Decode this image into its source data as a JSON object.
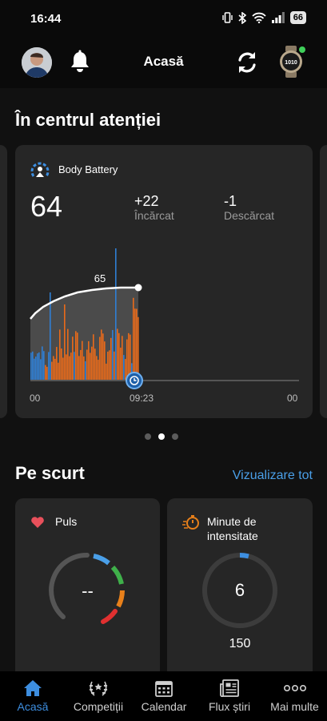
{
  "status_bar": {
    "time": "16:44",
    "battery": "66"
  },
  "header": {
    "title": "Acasă"
  },
  "spotlight": {
    "title": "În centrul atenției",
    "card": {
      "title": "Body Battery",
      "value": "64",
      "charged_value": "+22",
      "charged_label": "Încărcat",
      "drained_value": "-1",
      "drained_label": "Descărcat",
      "peak_label": "65",
      "x_left": "00",
      "x_mid": "09:23",
      "x_right": "00"
    },
    "page_count": 3,
    "active_page": 2
  },
  "summary": {
    "title": "Pe scurt",
    "view_all": "Vizualizare tot",
    "pulse": {
      "title": "Puls",
      "value": "--"
    },
    "intensity": {
      "title_line1": "Minute de",
      "title_line2": "intensitate",
      "value": "6",
      "goal": "150",
      "progress": 0.04
    }
  },
  "nav": [
    {
      "label": "Acasă",
      "icon": "home-icon",
      "active": true
    },
    {
      "label": "Competiții",
      "icon": "laurel-icon",
      "active": false
    },
    {
      "label": "Calendar",
      "icon": "calendar-icon",
      "active": false
    },
    {
      "label": "Flux știri",
      "icon": "newsfeed-icon",
      "active": false
    },
    {
      "label": "Mai multe",
      "icon": "more-icon",
      "active": false
    }
  ],
  "colors": {
    "accent": "#3d8ee0",
    "link": "#4a9fe8",
    "stress": "#e86a1a",
    "rest": "#2f7fd4",
    "heart": "#e8505b"
  }
}
